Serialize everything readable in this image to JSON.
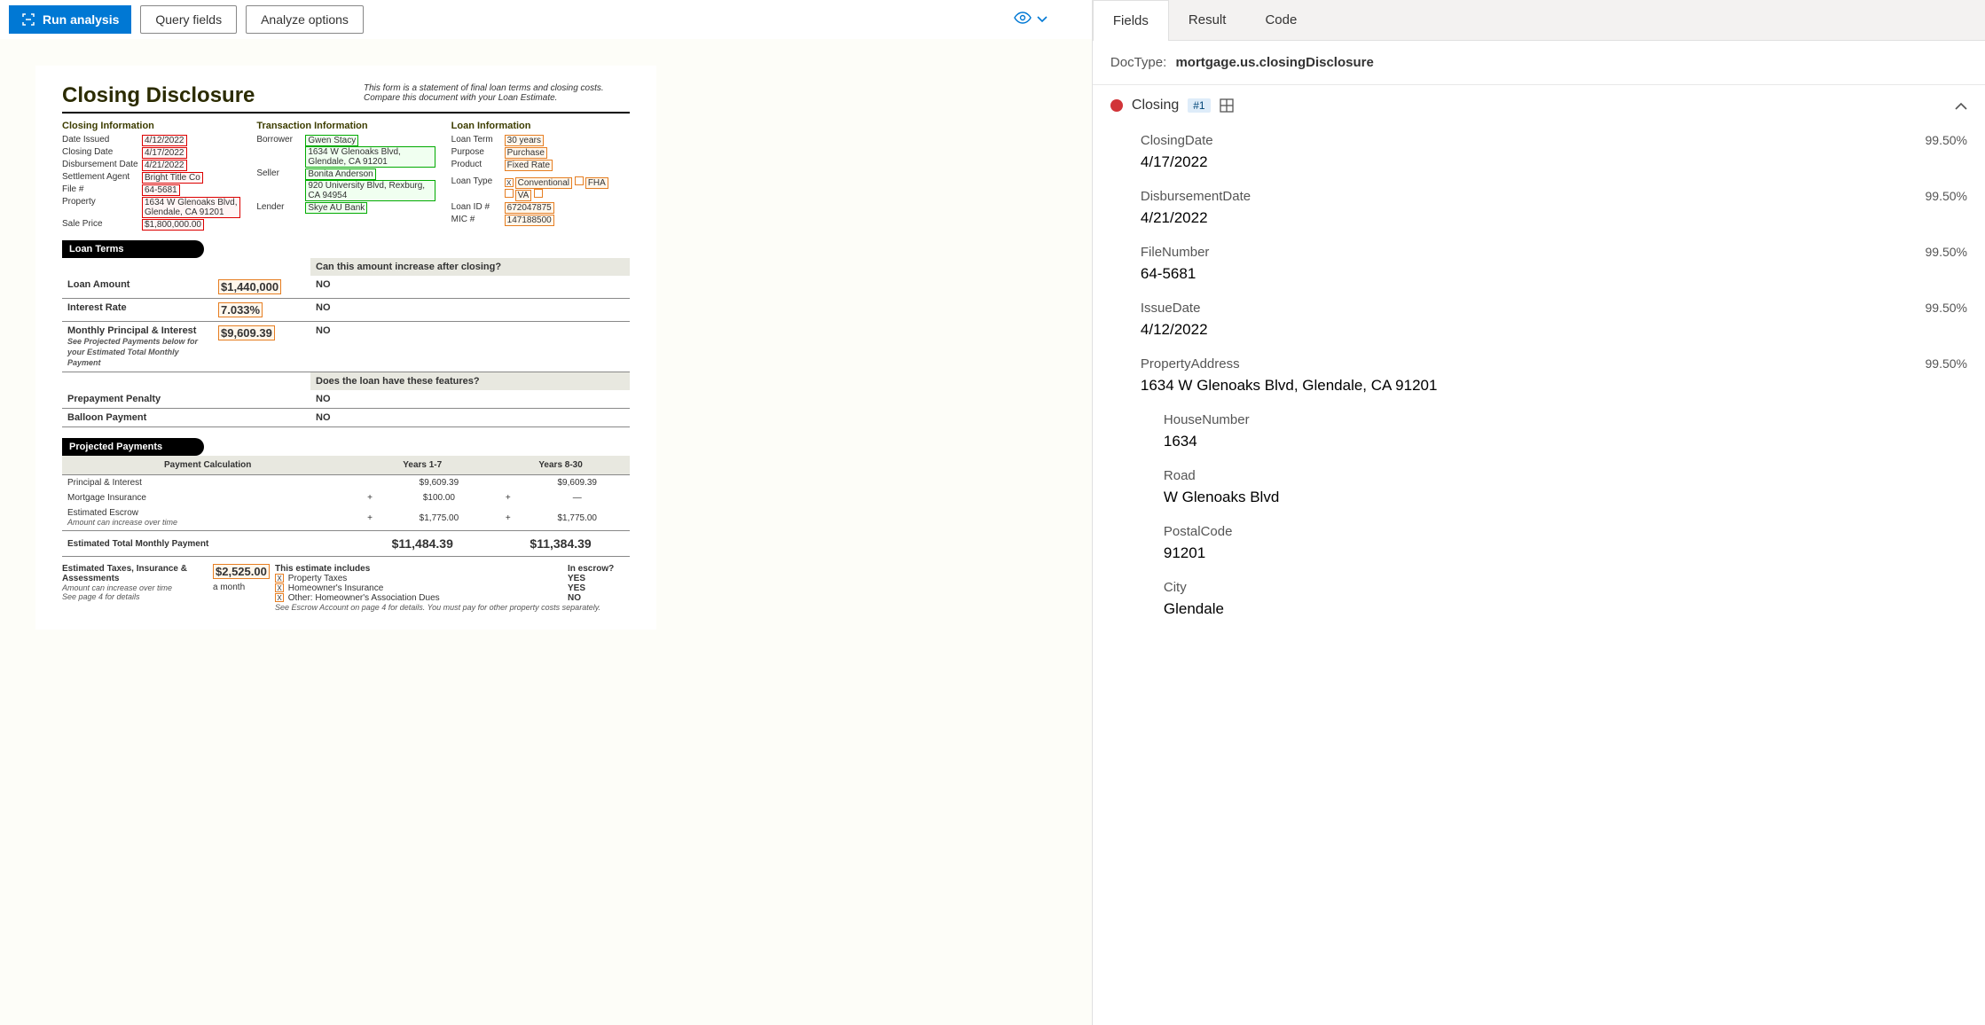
{
  "toolbar": {
    "run_label": "Run analysis",
    "query_label": "Query fields",
    "analyze_label": "Analyze options"
  },
  "document": {
    "title": "Closing Disclosure",
    "subtitle": "This form is a statement of final loan terms and closing costs. Compare this document with your Loan Estimate.",
    "closing_info_header": "Closing Information",
    "closing_info": {
      "date_issued_label": "Date Issued",
      "date_issued": "4/12/2022",
      "closing_date_label": "Closing Date",
      "closing_date": "4/17/2022",
      "disbursement_label": "Disbursement Date",
      "disbursement": "4/21/2022",
      "settlement_label": "Settlement Agent",
      "settlement": "Bright Title Co",
      "file_label": "File #",
      "file": "64-5681",
      "property_label": "Property",
      "property": "1634 W Glenoaks Blvd, Glendale, CA 91201",
      "sale_price_label": "Sale Price",
      "sale_price": "$1,800,000.00"
    },
    "transaction_info_header": "Transaction Information",
    "transaction_info": {
      "borrower_label": "Borrower",
      "borrower_name": "Gwen Stacy",
      "borrower_addr": "1634 W Glenoaks Blvd, Glendale, CA 91201",
      "seller_label": "Seller",
      "seller_name": "Bonita Anderson",
      "seller_addr": "920 University Blvd, Rexburg, CA 94954",
      "lender_label": "Lender",
      "lender": "Skye AU Bank"
    },
    "loan_info_header": "Loan Information",
    "loan_info": {
      "term_label": "Loan Term",
      "term": "30 years",
      "purpose_label": "Purpose",
      "purpose": "Purchase",
      "product_label": "Product",
      "product": "Fixed Rate",
      "type_label": "Loan Type",
      "type_conv": "Conventional",
      "type_fha": "FHA",
      "type_va": "VA",
      "id_label": "Loan ID #",
      "id": "672047875",
      "mic_label": "MIC #",
      "mic": "147188500"
    },
    "loan_terms_header": "Loan Terms",
    "q_increase": "Can this amount increase after closing?",
    "loan_amount_label": "Loan Amount",
    "loan_amount": "$1,440,000",
    "loan_amount_inc": "NO",
    "interest_label": "Interest Rate",
    "interest": "7.033%",
    "interest_inc": "NO",
    "monthly_label": "Monthly Principal & Interest",
    "monthly": "$9,609.39",
    "monthly_inc": "NO",
    "monthly_note": "See Projected Payments below for your Estimated Total Monthly Payment",
    "q_features": "Does the loan have these features?",
    "prepay_label": "Prepayment Penalty",
    "prepay": "NO",
    "balloon_label": "Balloon Payment",
    "balloon": "NO",
    "projected_header": "Projected Payments",
    "payment_calc_label": "Payment Calculation",
    "years_1_7": "Years 1-7",
    "years_8_30": "Years 8-30",
    "pi_label": "Principal & Interest",
    "pi_1": "$9,609.39",
    "pi_2": "$9,609.39",
    "mi_label": "Mortgage Insurance",
    "mi_1": "$100.00",
    "mi_2": "—",
    "ee_label": "Estimated Escrow",
    "ee_note": "Amount can increase over time",
    "ee_1": "$1,775.00",
    "ee_2": "$1,775.00",
    "etm_label": "Estimated Total Monthly Payment",
    "etm_1": "$11,484.39",
    "etm_2": "$11,384.39",
    "eta_label": "Estimated Taxes, Insurance & Assessments",
    "eta_note1": "Amount can increase over time",
    "eta_note2": "See page 4 for details",
    "eta_amount": "$2,525.00",
    "eta_per": "a month",
    "includes_header": "This estimate includes",
    "escrow_header": "In escrow?",
    "inc_1": "Property Taxes",
    "esc_1": "YES",
    "inc_2": "Homeowner's Insurance",
    "esc_2": "YES",
    "inc_3": "Other: Homeowner's Association Dues",
    "esc_3": "NO",
    "escrow_note": "See Escrow Account on page 4 for details. You must pay for other property costs separately."
  },
  "panel": {
    "tabs": {
      "fields": "Fields",
      "result": "Result",
      "code": "Code"
    },
    "doctype_label": "DocType:",
    "doctype_value": "mortgage.us.closingDisclosure",
    "group_title": "Closing",
    "group_badge": "#1",
    "fields": [
      {
        "name": "ClosingDate",
        "conf": "99.50%",
        "value": "4/17/2022"
      },
      {
        "name": "DisbursementDate",
        "conf": "99.50%",
        "value": "4/21/2022"
      },
      {
        "name": "FileNumber",
        "conf": "99.50%",
        "value": "64-5681"
      },
      {
        "name": "IssueDate",
        "conf": "99.50%",
        "value": "4/12/2022"
      },
      {
        "name": "PropertyAddress",
        "conf": "99.50%",
        "value": "1634 W Glenoaks Blvd, Glendale, CA 91201"
      }
    ],
    "subfields": [
      {
        "name": "HouseNumber",
        "value": "1634"
      },
      {
        "name": "Road",
        "value": "W Glenoaks Blvd"
      },
      {
        "name": "PostalCode",
        "value": "91201"
      },
      {
        "name": "City",
        "value": "Glendale"
      }
    ]
  }
}
